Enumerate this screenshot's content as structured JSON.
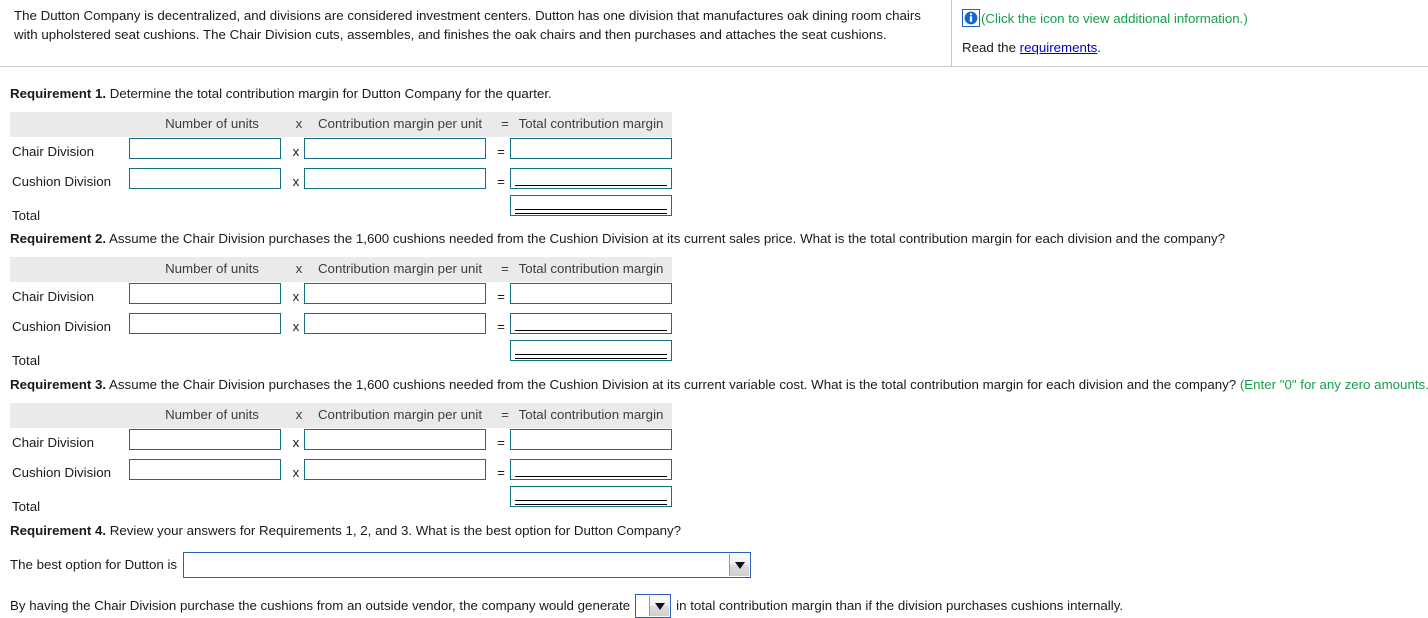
{
  "scenario": {
    "text": "The Dutton Company is decentralized, and divisions are considered investment centers. Dutton has one division that manufactures oak dining room chairs with upholstered seat cushions. The Chair Division cuts, assembles, and finishes the oak chairs and then purchases and attaches the seat cushions."
  },
  "info_panel": {
    "icon_name": "info-icon",
    "icon_note": "(Click the icon to view additional information.)",
    "read_prefix": "Read the ",
    "read_link": "requirements",
    "read_suffix": ".",
    "note_color": "#14a04a",
    "link_color": "#0000cc"
  },
  "table_headers": {
    "units": "Number of units",
    "x": "x",
    "cmu": "Contribution margin per unit",
    "eq": "=",
    "total": "Total contribution margin"
  },
  "row_labels": {
    "chair": "Chair Division",
    "cushion": "Cushion Division",
    "total": "Total"
  },
  "operators": {
    "times": "x",
    "equals": "="
  },
  "requirements": [
    {
      "label": "Requirement 1.",
      "text": " Determine the total contribution margin for Dutton Company for the quarter.",
      "hint": ""
    },
    {
      "label": "Requirement 2.",
      "text": " Assume the Chair Division purchases the 1,600 cushions needed from the Cushion Division at its current sales price. What is the total contribution margin for each division and the company?",
      "hint": ""
    },
    {
      "label": "Requirement 3.",
      "text": " Assume the Chair Division purchases the 1,600 cushions needed from the Cushion Division at its current variable cost. What is the total contribution margin for each division and the company? ",
      "hint": "(Enter \"0\" for any zero amounts.)"
    },
    {
      "label": "Requirement 4.",
      "text": " Review your answers for Requirements 1, 2, and 3. What is the best option for Dutton Company?",
      "hint": ""
    }
  ],
  "inputs": {
    "value": "",
    "placeholder": ""
  },
  "requirement4": {
    "best_option_label": "The best option for Dutton is",
    "best_option_value": "",
    "closing_prefix": "By having the Chair Division purchase the cushions from an outside vendor, the company would generate",
    "closing_select_value": "",
    "closing_suffix": "in total contribution margin than if the division purchases cushions internally."
  },
  "colors": {
    "input_border": "#16707f",
    "select_border": "#2a5cb8",
    "header_band": "#eaeaea"
  }
}
